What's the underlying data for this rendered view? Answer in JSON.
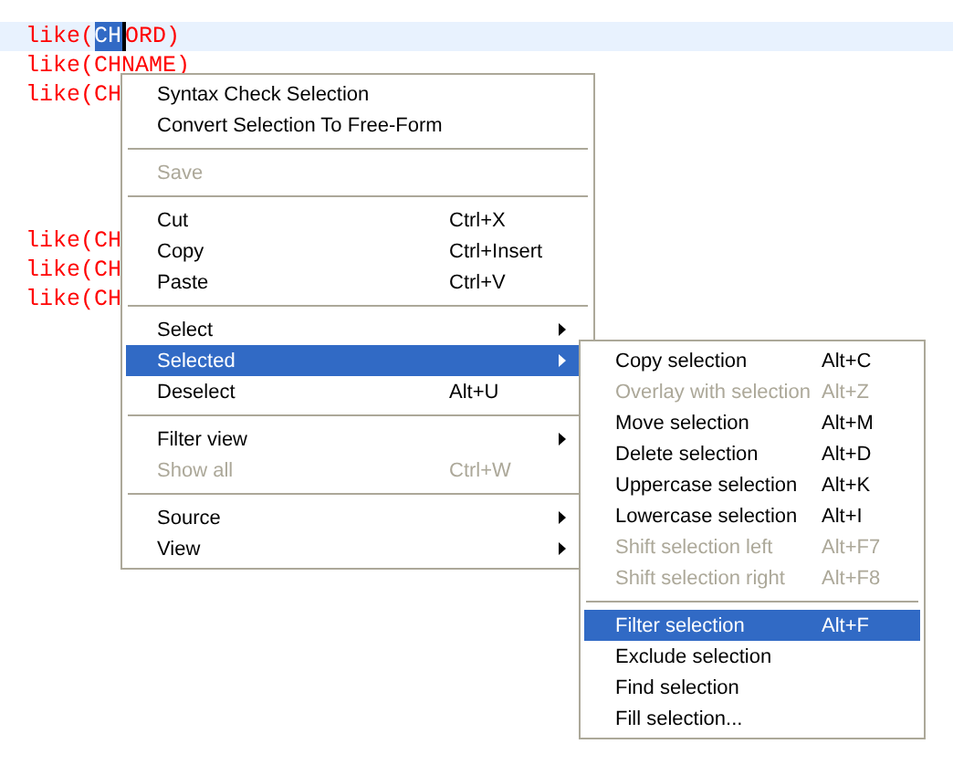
{
  "editor": {
    "lines": [
      {
        "kind": "code",
        "current": true,
        "segments": [
          {
            "text": "like(",
            "selected": false
          },
          {
            "text": "CH",
            "selected": true
          },
          {
            "text": "ORD)",
            "selected": false
          }
        ]
      },
      {
        "kind": "code",
        "current": false,
        "segments": [
          {
            "text": "like(CHNAME)",
            "selected": false
          }
        ]
      },
      {
        "kind": "code",
        "current": false,
        "segments": [
          {
            "text": "like(CH",
            "selected": false
          }
        ]
      },
      {
        "kind": "blank"
      },
      {
        "kind": "blank"
      },
      {
        "kind": "blank"
      },
      {
        "kind": "blank"
      },
      {
        "kind": "code",
        "current": false,
        "segments": [
          {
            "text": "like(CH",
            "selected": false
          }
        ]
      },
      {
        "kind": "code",
        "current": false,
        "segments": [
          {
            "text": "like(CH",
            "selected": false
          }
        ]
      },
      {
        "kind": "code",
        "current": false,
        "segments": [
          {
            "text": "like(CH",
            "selected": false
          }
        ]
      }
    ]
  },
  "context_menu": {
    "items": [
      {
        "kind": "item",
        "label": "Syntax Check Selection",
        "disabled": false,
        "selected": false,
        "submenu": false
      },
      {
        "kind": "item",
        "label": "Convert Selection To Free-Form",
        "disabled": false,
        "selected": false,
        "submenu": false
      },
      {
        "kind": "separator"
      },
      {
        "kind": "item",
        "label": "Save",
        "disabled": true,
        "selected": false,
        "submenu": false
      },
      {
        "kind": "separator"
      },
      {
        "kind": "item",
        "label": "Cut",
        "shortcut": "Ctrl+X",
        "disabled": false,
        "selected": false,
        "submenu": false
      },
      {
        "kind": "item",
        "label": "Copy",
        "shortcut": "Ctrl+Insert",
        "disabled": false,
        "selected": false,
        "submenu": false
      },
      {
        "kind": "item",
        "label": "Paste",
        "shortcut": "Ctrl+V",
        "disabled": false,
        "selected": false,
        "submenu": false
      },
      {
        "kind": "separator"
      },
      {
        "kind": "item",
        "label": "Select",
        "disabled": false,
        "selected": false,
        "submenu": true
      },
      {
        "kind": "item",
        "label": "Selected",
        "disabled": false,
        "selected": true,
        "submenu": true
      },
      {
        "kind": "item",
        "label": "Deselect",
        "shortcut": "Alt+U",
        "disabled": false,
        "selected": false,
        "submenu": false
      },
      {
        "kind": "separator"
      },
      {
        "kind": "item",
        "label": "Filter view",
        "disabled": false,
        "selected": false,
        "submenu": true
      },
      {
        "kind": "item",
        "label": "Show all",
        "shortcut": "Ctrl+W",
        "disabled": true,
        "selected": false,
        "submenu": false
      },
      {
        "kind": "separator"
      },
      {
        "kind": "item",
        "label": "Source",
        "disabled": false,
        "selected": false,
        "submenu": true
      },
      {
        "kind": "item",
        "label": "View",
        "disabled": false,
        "selected": false,
        "submenu": true
      }
    ]
  },
  "submenu": {
    "items": [
      {
        "kind": "item",
        "label": "Copy selection",
        "shortcut": "Alt+C",
        "disabled": false,
        "selected": false,
        "submenu": false
      },
      {
        "kind": "item",
        "label": "Overlay with selection",
        "shortcut": "Alt+Z",
        "disabled": true,
        "selected": false,
        "submenu": false
      },
      {
        "kind": "item",
        "label": "Move selection",
        "shortcut": "Alt+M",
        "disabled": false,
        "selected": false,
        "submenu": false
      },
      {
        "kind": "item",
        "label": "Delete selection",
        "shortcut": "Alt+D",
        "disabled": false,
        "selected": false,
        "submenu": false
      },
      {
        "kind": "item",
        "label": "Uppercase selection",
        "shortcut": "Alt+K",
        "disabled": false,
        "selected": false,
        "submenu": false
      },
      {
        "kind": "item",
        "label": "Lowercase selection",
        "shortcut": "Alt+I",
        "disabled": false,
        "selected": false,
        "submenu": false
      },
      {
        "kind": "item",
        "label": "Shift selection left",
        "shortcut": "Alt+F7",
        "disabled": true,
        "selected": false,
        "submenu": false
      },
      {
        "kind": "item",
        "label": "Shift selection right",
        "shortcut": "Alt+F8",
        "disabled": true,
        "selected": false,
        "submenu": false
      },
      {
        "kind": "separator"
      },
      {
        "kind": "item",
        "label": "Filter selection",
        "shortcut": "Alt+F",
        "disabled": false,
        "selected": true,
        "submenu": false
      },
      {
        "kind": "item",
        "label": "Exclude selection",
        "disabled": false,
        "selected": false,
        "submenu": false
      },
      {
        "kind": "item",
        "label": "Find selection",
        "disabled": false,
        "selected": false,
        "submenu": false
      },
      {
        "kind": "item",
        "label": "Fill selection...",
        "disabled": false,
        "selected": false,
        "submenu": false
      }
    ]
  }
}
